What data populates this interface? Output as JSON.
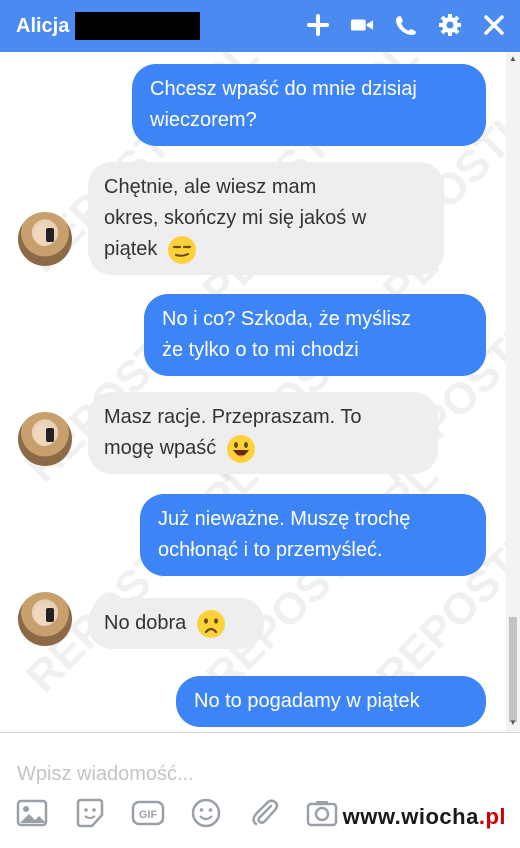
{
  "header": {
    "title": "Alicja",
    "bg": "#4a8af1"
  },
  "messages": [
    {
      "dir": "out",
      "lines": [
        "Chcesz wpaść do mnie dzisiaj",
        "wieczorem?"
      ]
    },
    {
      "dir": "in",
      "lines": [
        "Chętnie, ale wiesz mam",
        "okres, skończy mi się jakoś w",
        "piątek"
      ],
      "emoji": "smirk"
    },
    {
      "dir": "out",
      "lines": [
        "No i co? Szkoda, że myślisz",
        "że tylko o to mi chodzi"
      ]
    },
    {
      "dir": "in",
      "lines": [
        "Masz racje. Przepraszam. To",
        "mogę wpaść"
      ],
      "emoji": "grin"
    },
    {
      "dir": "out",
      "lines": [
        "Już nieważne. Muszę trochę",
        "ochłonąć i to przemyśleć."
      ]
    },
    {
      "dir": "in",
      "lines": [
        "No dobra"
      ],
      "emoji": "frown"
    },
    {
      "dir": "out",
      "lines": [
        "No to pogadamy w piątek"
      ]
    }
  ],
  "composer": {
    "placeholder": "Wpisz wiadomość..."
  },
  "watermark": "REPOSTUJ.PL",
  "logo": {
    "text": "www.wiocha",
    "tld": ".pl"
  },
  "colors": {
    "outgoing": "#3d84f7",
    "incoming": "#eeeef0"
  },
  "icons": [
    "plus-icon",
    "video-icon",
    "phone-icon",
    "gear-icon",
    "close-icon",
    "photo-icon",
    "sticker-icon",
    "gif-icon",
    "emoji-icon",
    "attachment-icon",
    "camera-icon",
    "like-icon"
  ]
}
